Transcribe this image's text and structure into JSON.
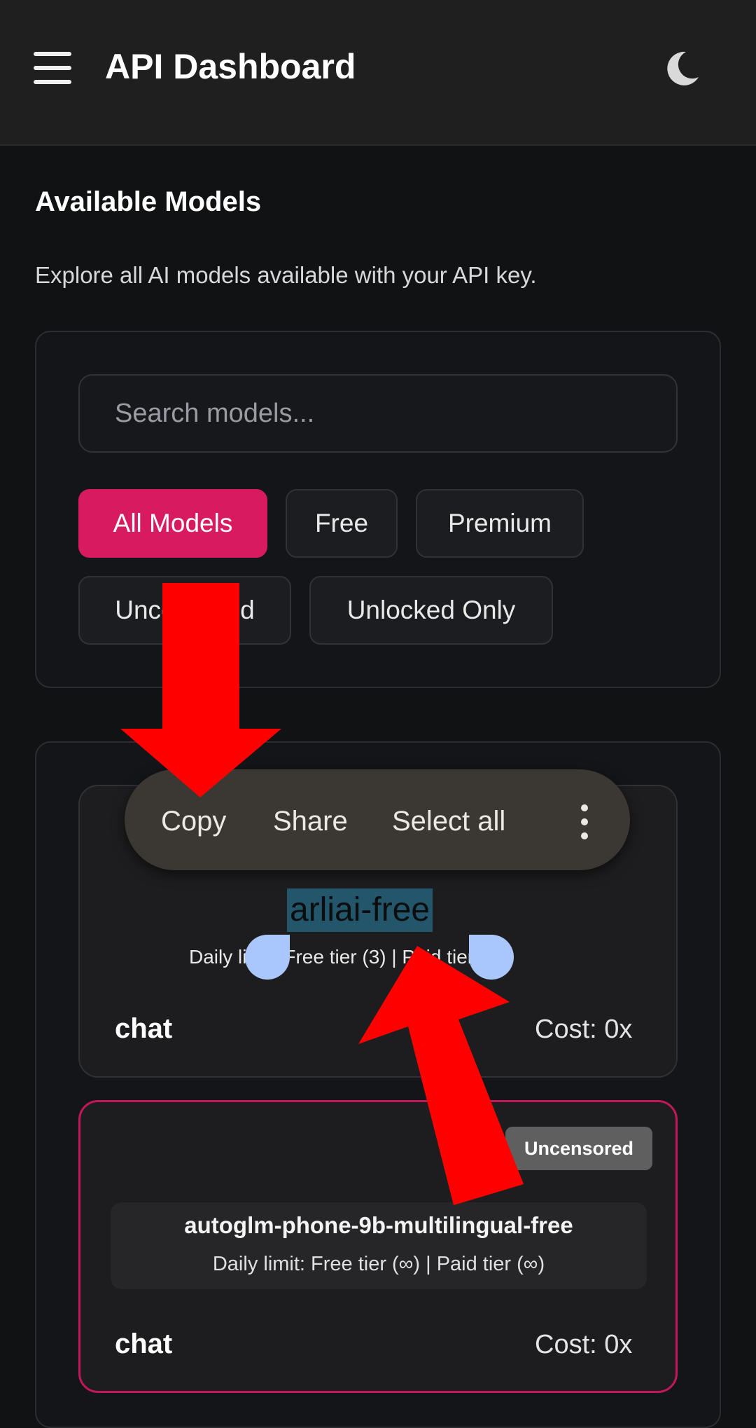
{
  "header": {
    "title": "API Dashboard",
    "menu_icon": "hamburger-menu-icon",
    "theme_icon": "moon-icon"
  },
  "page": {
    "title": "Available Models",
    "subtitle": "Explore all AI models available with your API key."
  },
  "filters": {
    "search_placeholder": "Search models...",
    "chips": [
      {
        "label": "All Models",
        "active": true
      },
      {
        "label": "Free",
        "active": false
      },
      {
        "label": "Premium",
        "active": false
      },
      {
        "label": "Uncensored",
        "active": false
      },
      {
        "label": "Unlocked Only",
        "active": false
      }
    ]
  },
  "context_menu": {
    "items": [
      "Copy",
      "Share",
      "Select all"
    ],
    "more_icon": "more-vertical-icon"
  },
  "models": [
    {
      "name": "arliai-free",
      "limit_text": "Daily limit: Free tier (3) | Paid tier (∞)",
      "category": "chat",
      "cost": "Cost: 0x",
      "badge": ""
    },
    {
      "name": "autoglm-phone-9b-multilingual-free",
      "limit_text": "Daily limit: Free tier (∞) | Paid tier (∞)",
      "category": "chat",
      "cost": "Cost: 0x",
      "badge": "Uncensored"
    }
  ],
  "colors": {
    "accent": "#d81b60",
    "annotation_arrow": "#ff0000",
    "selection": "#23566a",
    "selection_handle": "#a9c7fb"
  }
}
